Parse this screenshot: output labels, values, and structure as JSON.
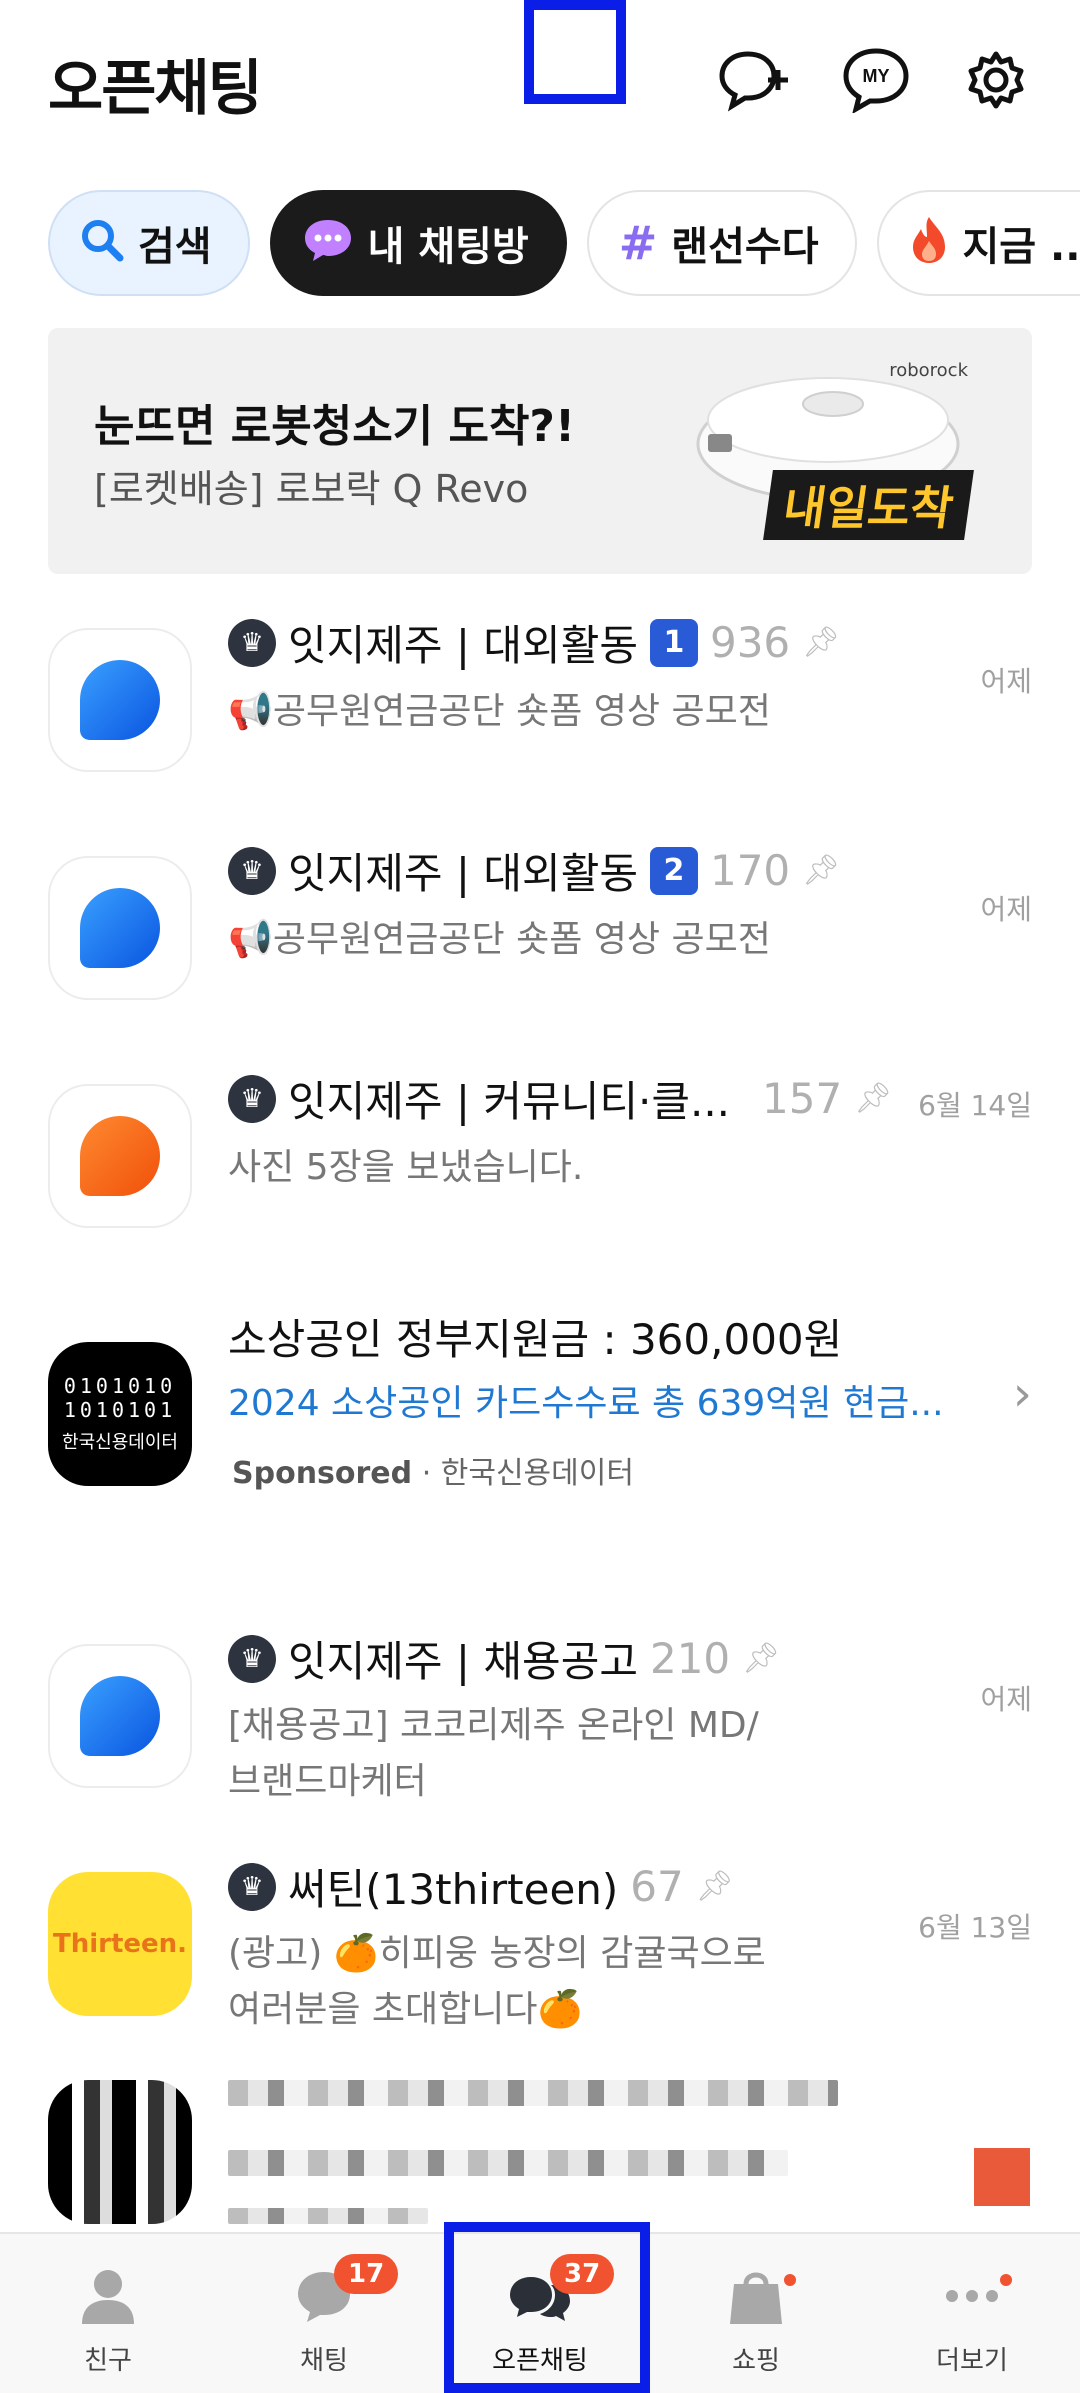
{
  "header": {
    "title": "오픈채팅",
    "icons": [
      "chat-add-icon",
      "my-profile-icon",
      "gear-icon"
    ],
    "my_label": "MY"
  },
  "chips": [
    {
      "label": "검색",
      "icon": "search-icon"
    },
    {
      "label": "내 채팅방",
      "icon": "chat-bubble-icon"
    },
    {
      "label": "랜선수다",
      "icon": "hashtag-icon"
    },
    {
      "label": "지금 ...",
      "icon": "fire-icon"
    }
  ],
  "banner": {
    "title": "눈뜨면 로봇청소기 도착?!",
    "subtitle": "[로켓배송] 로보락 Q Revo",
    "brand": "roborock",
    "tag": "내일도착"
  },
  "rooms": [
    {
      "name": "잇지제주 | 대외활동",
      "badge": "1",
      "count": "936",
      "message": "📢공무원연금공단 숏폼 영상 공모전",
      "time": "어제",
      "avatar": "blue"
    },
    {
      "name": "잇지제주 | 대외활동",
      "badge": "2",
      "count": "170",
      "message": "📢공무원연금공단 숏폼 영상 공모전",
      "time": "어제",
      "avatar": "blue"
    },
    {
      "name": "잇지제주 | 커뮤니티·클...",
      "count": "157",
      "message": "사진 5장을 보냈습니다.",
      "time": "6월 14일",
      "avatar": "orange"
    }
  ],
  "ad": {
    "avatar_bin1": "0101010",
    "avatar_bin2": "1010101",
    "avatar_text": "한국신용데이터",
    "title": "소상공인 정부지원금 : 360,000원",
    "desc": "2024 소상공인 카드수수료 총 639억원 현금...",
    "sponsored": "Sponsored",
    "advertiser": "· 한국신용데이터"
  },
  "rooms2": [
    {
      "name": "잇지제주 | 채용공고",
      "count": "210",
      "message1": "[채용공고] 코코리제주 온라인 MD/",
      "message2": "브랜드마케터",
      "time": "어제"
    },
    {
      "name": "써틴(13thirteen)",
      "count": "67",
      "message1": "(광고) 🍊히피웅 농장의 감귤국으로",
      "message2": "여러분을 초대합니다🍊",
      "time": "6월 13일",
      "avatar_text": "Thirteen."
    }
  ],
  "nav": [
    {
      "label": "친구",
      "icon": "person-icon"
    },
    {
      "label": "채팅",
      "icon": "chat-icon",
      "badge": "17"
    },
    {
      "label": "오픈채팅",
      "icon": "open-chat-icon",
      "badge": "37"
    },
    {
      "label": "쇼핑",
      "icon": "shopping-bag-icon"
    },
    {
      "label": "더보기",
      "icon": "more-icon"
    }
  ],
  "colors": {
    "highlight": "#0a1ee8",
    "badge": "#f1522f",
    "link": "#1f78d1"
  }
}
